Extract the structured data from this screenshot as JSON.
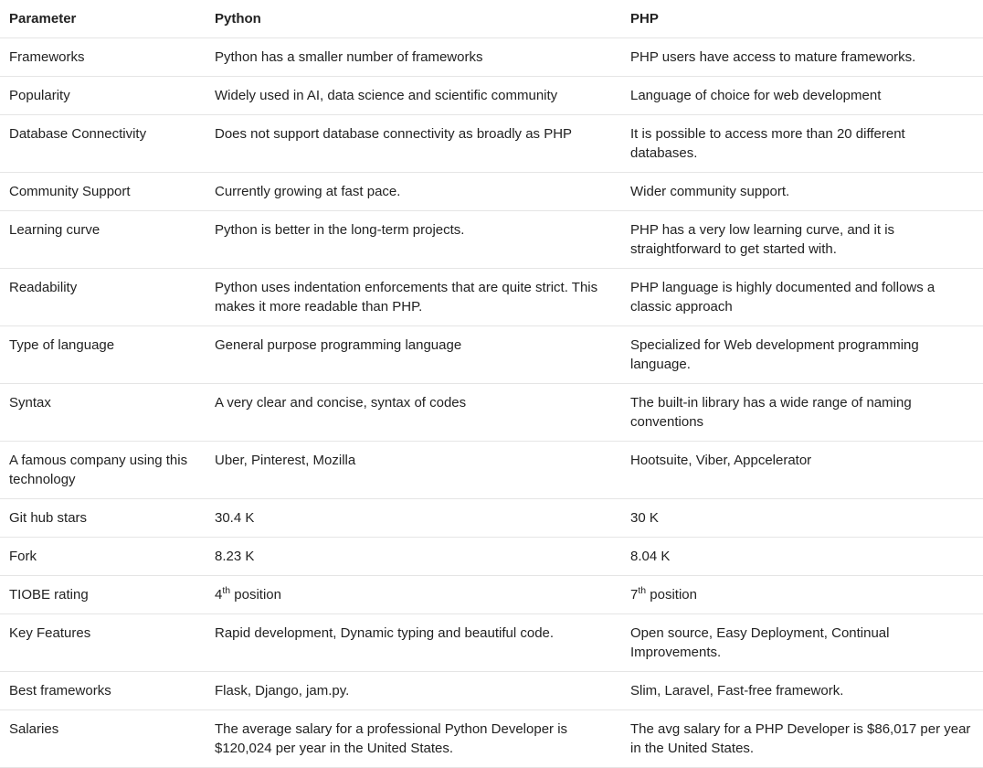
{
  "headers": [
    "Parameter",
    "Python",
    "PHP"
  ],
  "rows": [
    {
      "parameter": "Frameworks",
      "python": "Python has a smaller number of frameworks",
      "php": "PHP users have access to mature frameworks."
    },
    {
      "parameter": "Popularity",
      "python": "Widely used in AI, data science and scientific community",
      "php": "Language of choice for web development"
    },
    {
      "parameter": "Database Connectivity",
      "python": "Does not support database connectivity as broadly as PHP",
      "php": "It is possible to access more than 20 different databases."
    },
    {
      "parameter": "Community Support",
      "python": "Currently growing at fast pace.",
      "php": "Wider community support."
    },
    {
      "parameter": "Learning curve",
      "python": "Python is better in the long-term projects.",
      "php": "PHP has a very low learning curve, and it is straightforward to get started with."
    },
    {
      "parameter": "Readability",
      "python": "Python uses indentation enforcements that are quite strict. This makes it more readable than PHP.",
      "php": "PHP language is highly documented and follows a classic approach"
    },
    {
      "parameter": "Type of language",
      "python": "General purpose programming language",
      "php": "Specialized for Web development programming language."
    },
    {
      "parameter": "Syntax",
      "python": "A very clear and concise, syntax of codes",
      "php": "The built-in library has a wide range of naming conventions"
    },
    {
      "parameter": "A famous company using this technology",
      "python": "Uber, Pinterest, Mozilla",
      "php": "Hootsuite, Viber, Appcelerator"
    },
    {
      "parameter": "Git hub stars",
      "python": "30.4 K",
      "php": "30 K"
    },
    {
      "parameter": "Fork",
      "python": "8.23 K",
      "php": "8.04 K"
    },
    {
      "parameter": "TIOBE rating",
      "python": {
        "rank": "4",
        "ord": "th",
        "suffix": " position"
      },
      "php": {
        "rank": "7",
        "ord": "th",
        "suffix": " position"
      }
    },
    {
      "parameter": "Key Features",
      "python": "Rapid development, Dynamic typing and beautiful code.",
      "php": "Open source, Easy Deployment, Continual Improvements."
    },
    {
      "parameter": "Best frameworks",
      "python": "Flask, Django, jam.py.",
      "php": "Slim, Laravel, Fast-free framework."
    },
    {
      "parameter": "Salaries",
      "python": "The average salary for a professional Python Developer is $120,024 per year in the United States.",
      "php": "The avg salary for a PHP Developer is $86,017 per year in the United States."
    }
  ]
}
